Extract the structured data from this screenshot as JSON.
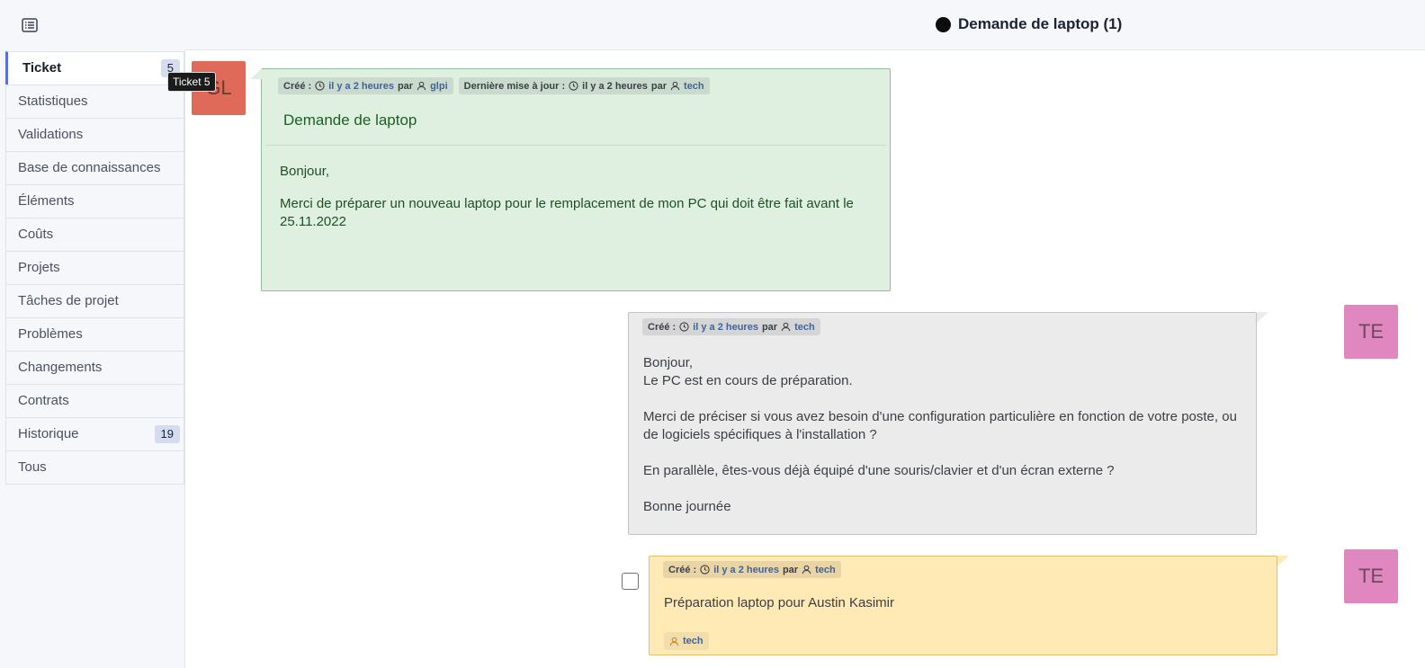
{
  "header": {
    "title": "Demande de laptop (1)"
  },
  "sidebar": {
    "items": [
      {
        "label": "Ticket",
        "badge": "5"
      },
      {
        "label": "Statistiques"
      },
      {
        "label": "Validations"
      },
      {
        "label": "Base de connaissances"
      },
      {
        "label": "Éléments"
      },
      {
        "label": "Coûts"
      },
      {
        "label": "Projets"
      },
      {
        "label": "Tâches de projet"
      },
      {
        "label": "Problèmes"
      },
      {
        "label": "Changements"
      },
      {
        "label": "Contrats"
      },
      {
        "label": "Historique",
        "badge": "19"
      },
      {
        "label": "Tous"
      }
    ],
    "tooltip": "Ticket 5"
  },
  "timeline": {
    "ticket": {
      "avatar": "GL",
      "created_label": "Créé :",
      "created_time": "il y a 2 heures",
      "by": "par",
      "created_user": "glpi",
      "updated_label": "Dernière mise à jour :",
      "updated_time": "il y a 2 heures",
      "updated_by": "par",
      "updated_user": "tech",
      "title": "Demande de laptop",
      "body_1": "Bonjour,",
      "body_2": "Merci de préparer un nouveau laptop pour le remplacement de mon PC qui doit être fait avant le",
      "body_3": "25.11.2022"
    },
    "followup": {
      "avatar": "TE",
      "created_label": "Créé :",
      "created_time": "il y a 2 heures",
      "by": "par",
      "created_user": "tech",
      "line_1": "Bonjour,",
      "line_2": "Le PC est en cours de préparation.",
      "line_3": "Merci de préciser si vous avez besoin d'une configuration particulière en fonction de votre poste, ou",
      "line_4": "de logiciels spécifiques à l'installation ?",
      "line_5": "En parallèle, êtes-vous déjà équipé d'une souris/clavier et d'un écran externe ?",
      "line_6": "Bonne journée"
    },
    "task": {
      "avatar": "TE",
      "created_label": "Créé :",
      "created_time": "il y a 2 heures",
      "by": "par",
      "created_user": "tech",
      "content": "Préparation laptop pour Austin Kasimir",
      "assigned_user": "tech"
    }
  },
  "colors": {
    "ticket_bg": "#dff0e1",
    "followup_bg": "#ebebeb",
    "task_bg": "#ffe9b5",
    "avatar_glpi": "#e06a59",
    "avatar_tech": "#df87be",
    "link": "#40639c"
  },
  "icons": {
    "menu": "list-icon",
    "time": "clock-icon",
    "user": "user-icon",
    "status": "status-circle-icon"
  }
}
